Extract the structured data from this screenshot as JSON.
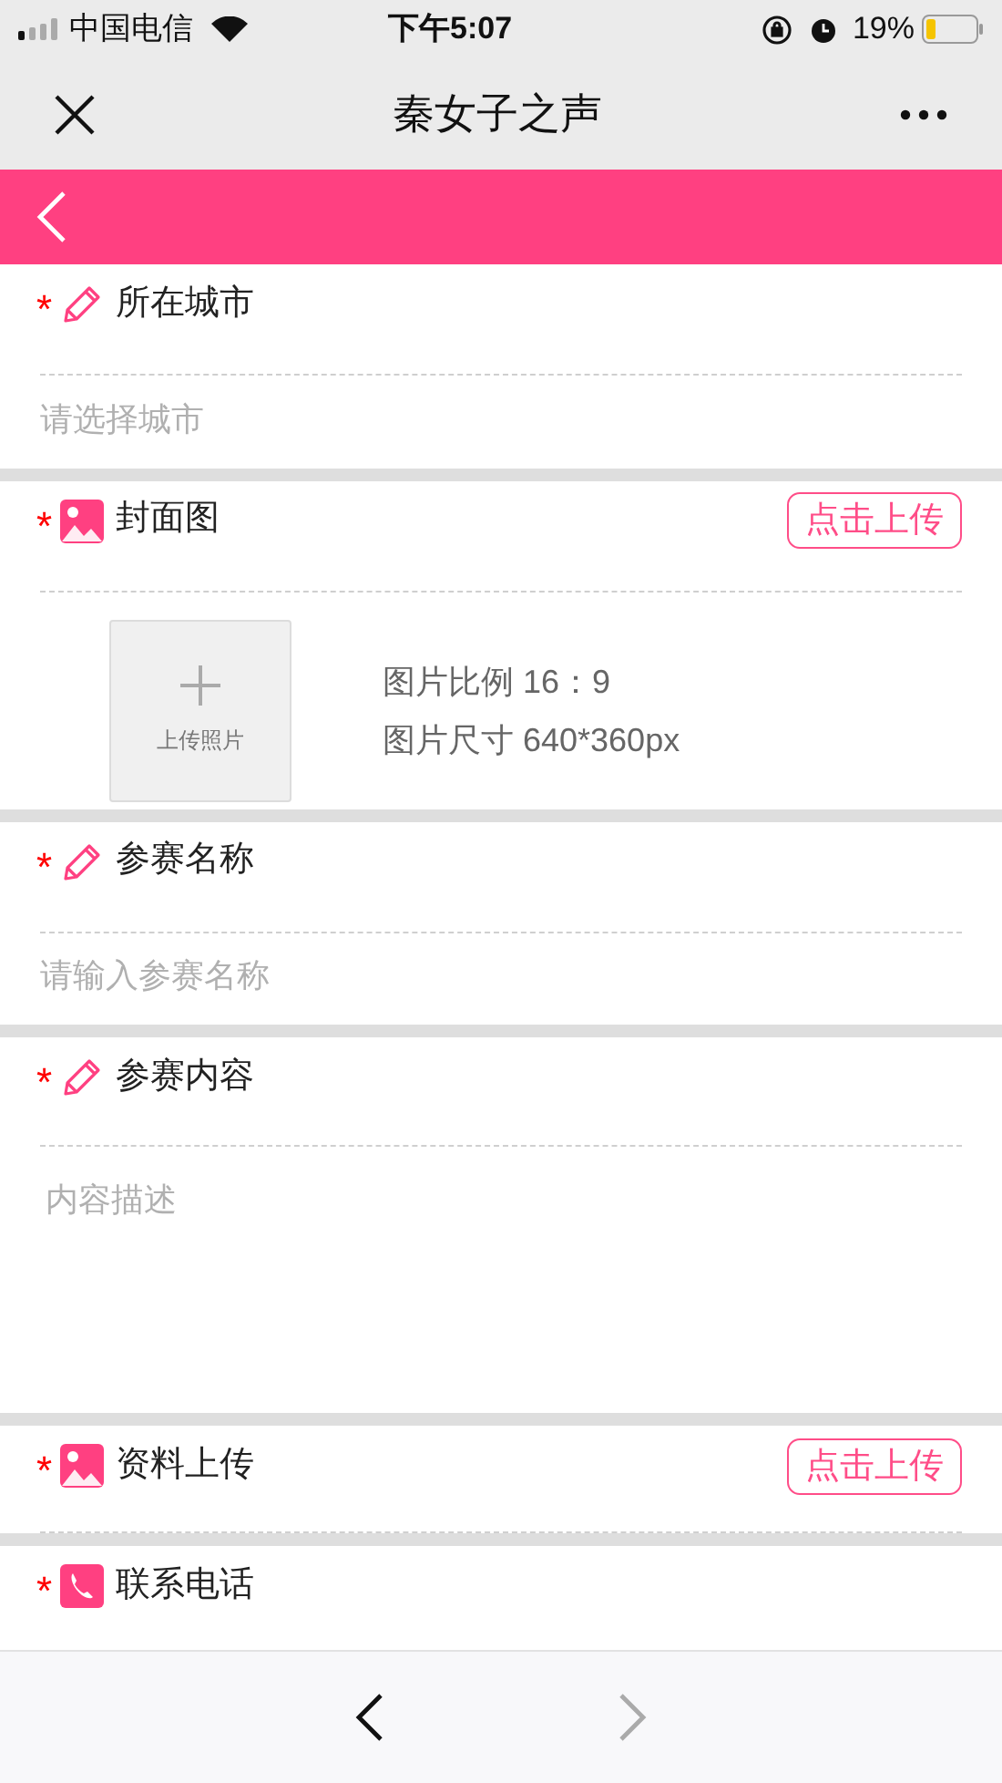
{
  "status_bar": {
    "carrier": "中国电信",
    "time": "下午5:07",
    "battery": "19%"
  },
  "nav": {
    "title": "秦女子之声"
  },
  "fields": [
    {
      "kind": "select",
      "required_mark": "*",
      "label": "所在城市",
      "placeholder": "请选择城市"
    },
    {
      "kind": "cover",
      "required_mark": "*",
      "label": "封面图",
      "button": "点击上传",
      "upload_label": "上传照片",
      "notes": [
        "图片比例 16：9",
        "图片尺寸 640*360px"
      ]
    },
    {
      "kind": "input",
      "required_mark": "*",
      "label": "参赛名称",
      "placeholder": "请输入参赛名称"
    },
    {
      "kind": "textarea",
      "required_mark": "*",
      "label": "参赛内容",
      "placeholder": "内容描述"
    },
    {
      "kind": "upload",
      "required_mark": "*",
      "label": "资料上传",
      "button": "点击上传"
    },
    {
      "kind": "cut",
      "required_mark": "*",
      "label": "联系电话"
    }
  ],
  "footer": {
    "back_disabled": false,
    "forward_disabled": true
  }
}
